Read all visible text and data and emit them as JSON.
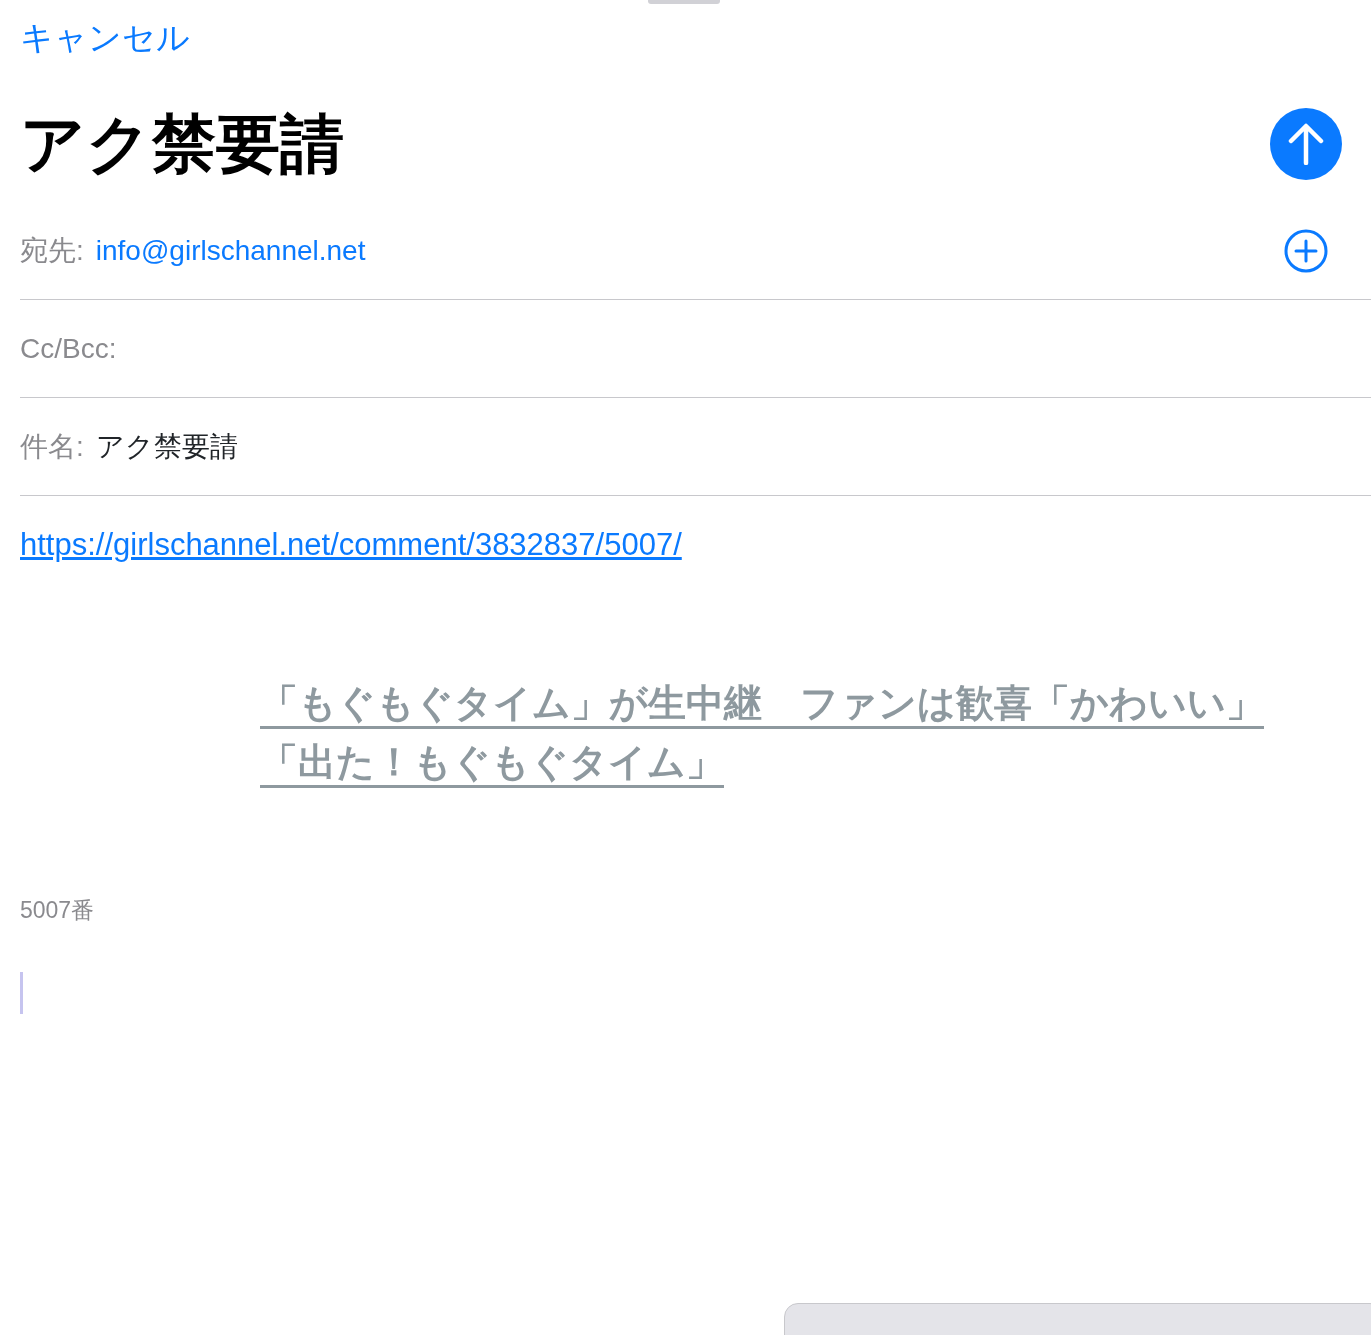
{
  "cancel": "キャンセル",
  "title": "アク禁要請",
  "fields": [
    {
      "kind": "recipient",
      "label": "宛先:",
      "value": "info@girlschannel.net"
    },
    {
      "kind": "plain",
      "label": "Cc/Bcc:"
    },
    {
      "kind": "subject",
      "label": "件名:",
      "value": "アク禁要請"
    }
  ],
  "body": {
    "link": "https://girlschannel.net/comment/3832837/5007/",
    "quote_lines": [
      "「もぐもぐタイム」が生中継　ファンは歓喜「かわいい」",
      "「出た！もぐもぐタイム」"
    ],
    "note": "5007番"
  }
}
